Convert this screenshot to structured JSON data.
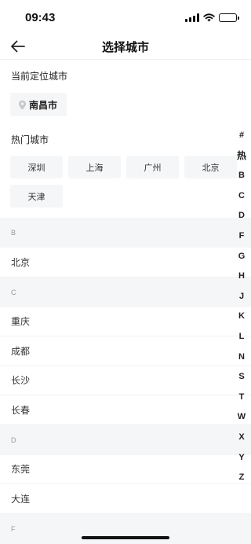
{
  "status_bar": {
    "time": "09:43"
  },
  "nav": {
    "title": "选择城市"
  },
  "current": {
    "label": "当前定位城市",
    "city": "南昌市"
  },
  "hot": {
    "label": "热门城市",
    "cities": [
      "深圳",
      "上海",
      "广州",
      "北京",
      "天津"
    ]
  },
  "groups": [
    {
      "letter": "B",
      "cities": [
        "北京"
      ]
    },
    {
      "letter": "C",
      "cities": [
        "重庆",
        "成都",
        "长沙",
        "长春"
      ]
    },
    {
      "letter": "D",
      "cities": [
        "东莞",
        "大连"
      ]
    },
    {
      "letter": "F",
      "cities": []
    }
  ],
  "index": [
    "#",
    "热",
    "B",
    "C",
    "D",
    "F",
    "G",
    "H",
    "J",
    "K",
    "L",
    "N",
    "S",
    "T",
    "W",
    "X",
    "Y",
    "Z"
  ],
  "colors": {
    "chip_bg": "#f5f6f7",
    "group_bg": "#f5f6f8",
    "text": "#222222"
  }
}
